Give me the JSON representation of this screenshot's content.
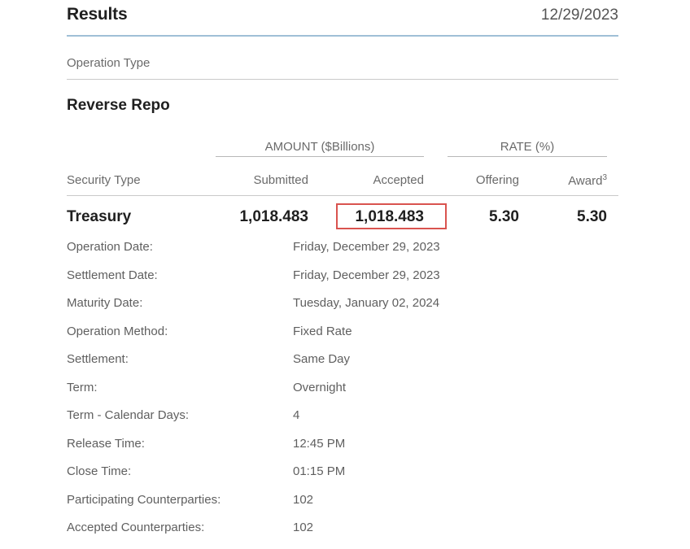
{
  "header": {
    "title": "Results",
    "date": "12/29/2023"
  },
  "operation_type_label": "Operation Type",
  "section_title": "Reverse Repo",
  "table": {
    "group_amount": "AMOUNT ($Billions)",
    "group_rate": "RATE (%)",
    "columns": {
      "security_type": "Security Type",
      "submitted": "Submitted",
      "accepted": "Accepted",
      "offering": "Offering",
      "award": "Award",
      "award_footnote": "3"
    },
    "row": {
      "security_type": "Treasury",
      "submitted": "1,018.483",
      "accepted": "1,018.483",
      "offering": "5.30",
      "award": "5.30"
    },
    "highlight_color": "#d9534f"
  },
  "details": [
    {
      "label": "Operation Date:",
      "value": "Friday, December 29, 2023"
    },
    {
      "label": "Settlement Date:",
      "value": "Friday, December 29, 2023"
    },
    {
      "label": "Maturity Date:",
      "value": "Tuesday, January 02, 2024"
    },
    {
      "label": "Operation Method:",
      "value": "Fixed Rate"
    },
    {
      "label": "Settlement:",
      "value": "Same Day"
    },
    {
      "label": "Term:",
      "value": "Overnight"
    },
    {
      "label": "Term - Calendar Days:",
      "value": "4"
    },
    {
      "label": "Release Time:",
      "value": "12:45 PM"
    },
    {
      "label": "Close Time:",
      "value": "01:15 PM"
    },
    {
      "label": "Participating Counterparties:",
      "value": "102"
    },
    {
      "label": "Accepted Counterparties:",
      "value": "102"
    }
  ]
}
